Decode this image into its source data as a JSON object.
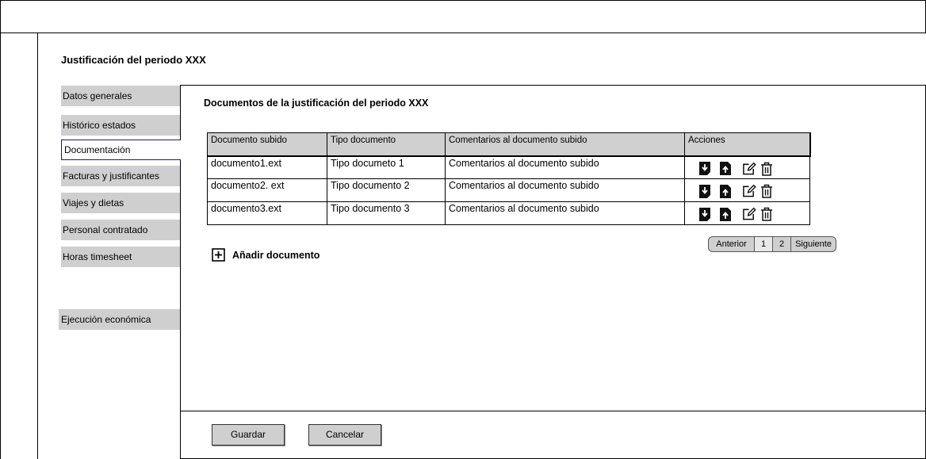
{
  "page": {
    "title": "Justificación del periodo XXX"
  },
  "sidebar": {
    "items": [
      {
        "label": "Datos generales"
      },
      {
        "label": "Histórico estados"
      },
      {
        "label": "Documentación"
      },
      {
        "label": "Facturas y justificantes"
      },
      {
        "label": "Viajes y dietas"
      },
      {
        "label": "Personal contratado"
      },
      {
        "label": "Horas timesheet"
      },
      {
        "label": "Ejecución económica"
      }
    ],
    "active": "Documentación"
  },
  "main": {
    "title": "Documentos de la justificación del periodo XXX",
    "table": {
      "columns": [
        "Documento subido",
        "Tipo documento",
        "Comentarios al documento subido",
        "Acciones"
      ],
      "rows": [
        [
          "documento1.ext",
          "Tipo documeto 1",
          "Comentarios al documento subido"
        ],
        [
          "documento2. ext",
          "Tipo documento 2",
          "Comentarios al documento subido"
        ],
        [
          "documento3.ext",
          "Tipo documento 3",
          "Comentarios al documento subido"
        ]
      ],
      "row_actions": [
        "download-icon",
        "upload-icon",
        "edit-icon",
        "trash-icon"
      ]
    },
    "pagination": {
      "prev": "Anterior",
      "pages": [
        "1",
        "2"
      ],
      "current": "2",
      "next": "Siguiente"
    },
    "add_document": "Añadir documento"
  },
  "footer": {
    "save": "Guardar",
    "cancel": "Cancelar"
  }
}
